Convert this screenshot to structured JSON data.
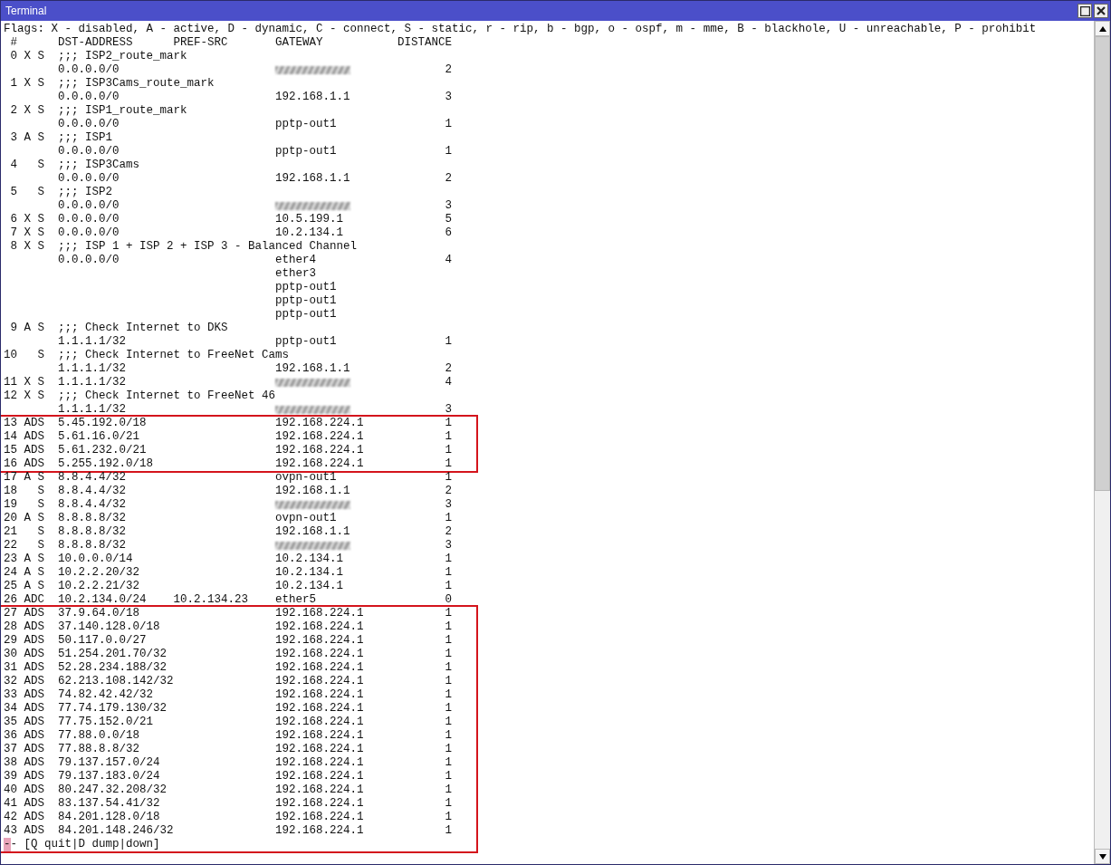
{
  "window": {
    "title": "Terminal"
  },
  "legend": "Flags: X - disabled, A - active, D - dynamic, C - connect, S - static, r - rip, b - bgp, o - ospf, m - mme, B - blackhole, U - unreachable, P - prohibit",
  "columns": {
    "num": "#",
    "dst": "DST-ADDRESS",
    "pref_src": "PREF-SRC",
    "gateway": "GATEWAY",
    "distance": "DISTANCE"
  },
  "sections": [
    {
      "highlighted": false,
      "routes": [
        {
          "num": "0",
          "flags": "X S",
          "comment": ";;; ISP2_route_mark",
          "dst": "0.0.0.0/0",
          "gateway_redacted": true,
          "distance": "2"
        },
        {
          "num": "1",
          "flags": "X S",
          "comment": ";;; ISP3Cams_route_mark",
          "dst": "0.0.0.0/0",
          "gateway": "192.168.1.1",
          "distance": "3"
        },
        {
          "num": "2",
          "flags": "X S",
          "comment": ";;; ISP1_route_mark",
          "dst": "0.0.0.0/0",
          "gateway": "pptp-out1",
          "distance": "1"
        },
        {
          "num": "3",
          "flags": "A S",
          "comment": ";;; ISP1",
          "dst": "0.0.0.0/0",
          "gateway": "pptp-out1",
          "distance": "1"
        },
        {
          "num": "4",
          "flags": "S",
          "comment": ";;; ISP3Cams",
          "dst": "0.0.0.0/0",
          "gateway": "192.168.1.1",
          "distance": "2"
        },
        {
          "num": "5",
          "flags": "S",
          "comment": ";;; ISP2",
          "dst": "0.0.0.0/0",
          "gateway_redacted": true,
          "distance": "3"
        },
        {
          "num": "6",
          "flags": "X S",
          "dst": "0.0.0.0/0",
          "gateway": "10.5.199.1",
          "distance": "5"
        },
        {
          "num": "7",
          "flags": "X S",
          "dst": "0.0.0.0/0",
          "gateway": "10.2.134.1",
          "distance": "6"
        },
        {
          "num": "8",
          "flags": "X S",
          "comment": ";;; ISP 1 + ISP 2 + ISP 3 - Balanced Channel",
          "dst": "0.0.0.0/0",
          "gateway": "ether4",
          "distance": "4",
          "extra_gateways": [
            "ether3",
            "pptp-out1",
            "pptp-out1",
            "pptp-out1"
          ]
        },
        {
          "num": "9",
          "flags": "A S",
          "comment": ";;; Check Internet to DKS",
          "dst": "1.1.1.1/32",
          "gateway": "pptp-out1",
          "distance": "1"
        },
        {
          "num": "10",
          "flags": "S",
          "comment": ";;; Check Internet to FreeNet Cams",
          "dst": "1.1.1.1/32",
          "gateway": "192.168.1.1",
          "distance": "2"
        },
        {
          "num": "11",
          "flags": "X S",
          "dst": "1.1.1.1/32",
          "gateway_redacted": true,
          "distance": "4"
        },
        {
          "num": "12",
          "flags": "X S",
          "comment": ";;; Check Internet to FreeNet 46",
          "dst": "1.1.1.1/32",
          "gateway_redacted": true,
          "distance": "3"
        }
      ]
    },
    {
      "highlighted": true,
      "routes": [
        {
          "num": "13",
          "flags": "ADS",
          "dst": "5.45.192.0/18",
          "gateway": "192.168.224.1",
          "distance": "1"
        },
        {
          "num": "14",
          "flags": "ADS",
          "dst": "5.61.16.0/21",
          "gateway": "192.168.224.1",
          "distance": "1"
        },
        {
          "num": "15",
          "flags": "ADS",
          "dst": "5.61.232.0/21",
          "gateway": "192.168.224.1",
          "distance": "1"
        },
        {
          "num": "16",
          "flags": "ADS",
          "dst": "5.255.192.0/18",
          "gateway": "192.168.224.1",
          "distance": "1"
        }
      ]
    },
    {
      "highlighted": false,
      "routes": [
        {
          "num": "17",
          "flags": "A S",
          "dst": "8.8.4.4/32",
          "gateway": "ovpn-out1",
          "distance": "1"
        },
        {
          "num": "18",
          "flags": "S",
          "dst": "8.8.4.4/32",
          "gateway": "192.168.1.1",
          "distance": "2"
        },
        {
          "num": "19",
          "flags": "S",
          "dst": "8.8.4.4/32",
          "gateway_redacted": true,
          "distance": "3"
        },
        {
          "num": "20",
          "flags": "A S",
          "dst": "8.8.8.8/32",
          "gateway": "ovpn-out1",
          "distance": "1"
        },
        {
          "num": "21",
          "flags": "S",
          "dst": "8.8.8.8/32",
          "gateway": "192.168.1.1",
          "distance": "2"
        },
        {
          "num": "22",
          "flags": "S",
          "dst": "8.8.8.8/32",
          "gateway_redacted": true,
          "distance": "3"
        },
        {
          "num": "23",
          "flags": "A S",
          "dst": "10.0.0.0/14",
          "gateway": "10.2.134.1",
          "distance": "1"
        },
        {
          "num": "24",
          "flags": "A S",
          "dst": "10.2.2.20/32",
          "gateway": "10.2.134.1",
          "distance": "1"
        },
        {
          "num": "25",
          "flags": "A S",
          "dst": "10.2.2.21/32",
          "gateway": "10.2.134.1",
          "distance": "1"
        },
        {
          "num": "26",
          "flags": "ADC",
          "dst": "10.2.134.0/24",
          "pref_src": "10.2.134.23",
          "gateway": "ether5",
          "distance": "0"
        }
      ]
    },
    {
      "highlighted": true,
      "prompt": "-- [Q quit|D dump|down]",
      "routes": [
        {
          "num": "27",
          "flags": "ADS",
          "dst": "37.9.64.0/18",
          "gateway": "192.168.224.1",
          "distance": "1"
        },
        {
          "num": "28",
          "flags": "ADS",
          "dst": "37.140.128.0/18",
          "gateway": "192.168.224.1",
          "distance": "1"
        },
        {
          "num": "29",
          "flags": "ADS",
          "dst": "50.117.0.0/27",
          "gateway": "192.168.224.1",
          "distance": "1"
        },
        {
          "num": "30",
          "flags": "ADS",
          "dst": "51.254.201.70/32",
          "gateway": "192.168.224.1",
          "distance": "1"
        },
        {
          "num": "31",
          "flags": "ADS",
          "dst": "52.28.234.188/32",
          "gateway": "192.168.224.1",
          "distance": "1"
        },
        {
          "num": "32",
          "flags": "ADS",
          "dst": "62.213.108.142/32",
          "gateway": "192.168.224.1",
          "distance": "1"
        },
        {
          "num": "33",
          "flags": "ADS",
          "dst": "74.82.42.42/32",
          "gateway": "192.168.224.1",
          "distance": "1"
        },
        {
          "num": "34",
          "flags": "ADS",
          "dst": "77.74.179.130/32",
          "gateway": "192.168.224.1",
          "distance": "1"
        },
        {
          "num": "35",
          "flags": "ADS",
          "dst": "77.75.152.0/21",
          "gateway": "192.168.224.1",
          "distance": "1"
        },
        {
          "num": "36",
          "flags": "ADS",
          "dst": "77.88.0.0/18",
          "gateway": "192.168.224.1",
          "distance": "1"
        },
        {
          "num": "37",
          "flags": "ADS",
          "dst": "77.88.8.8/32",
          "gateway": "192.168.224.1",
          "distance": "1"
        },
        {
          "num": "38",
          "flags": "ADS",
          "dst": "79.137.157.0/24",
          "gateway": "192.168.224.1",
          "distance": "1"
        },
        {
          "num": "39",
          "flags": "ADS",
          "dst": "79.137.183.0/24",
          "gateway": "192.168.224.1",
          "distance": "1"
        },
        {
          "num": "40",
          "flags": "ADS",
          "dst": "80.247.32.208/32",
          "gateway": "192.168.224.1",
          "distance": "1"
        },
        {
          "num": "41",
          "flags": "ADS",
          "dst": "83.137.54.41/32",
          "gateway": "192.168.224.1",
          "distance": "1"
        },
        {
          "num": "42",
          "flags": "ADS",
          "dst": "84.201.128.0/18",
          "gateway": "192.168.224.1",
          "distance": "1"
        },
        {
          "num": "43",
          "flags": "ADS",
          "dst": "84.201.148.246/32",
          "gateway": "192.168.224.1",
          "distance": "1"
        }
      ]
    }
  ]
}
